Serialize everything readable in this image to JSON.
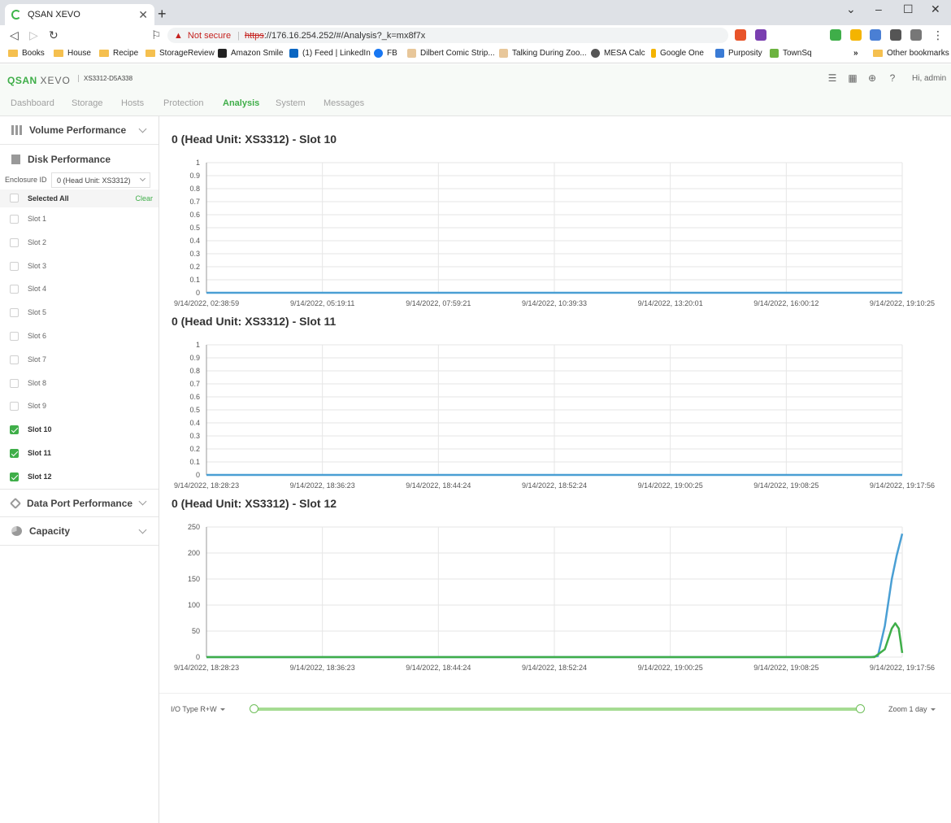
{
  "browser": {
    "tab_title": "QSAN XEVO",
    "tab_close": "✕",
    "new_tab": "+",
    "not_secure": "Not secure",
    "url_scheme": "https",
    "url_rest": "://176.16.254.252/#/Analysis?_k=mx8f7x",
    "bookmarks": [
      "Books",
      "House",
      "Recipe",
      "StorageReview",
      "Amazon Smile",
      "(1) Feed | LinkedIn",
      "FB",
      "Dilbert Comic Strip...",
      "Talking During Zoo...",
      "MESA Calc",
      "Google One",
      "Purposity",
      "TownSq"
    ],
    "bookmarks_more": "»",
    "other_bookmarks": "Other bookmarks"
  },
  "app": {
    "logo_brand": "QSAN",
    "logo_product": "XEVO",
    "model": "XS3312-D5A338",
    "greeting": "Hi, admin",
    "nav_tabs": [
      "Dashboard",
      "Storage",
      "Hosts",
      "Protection",
      "Analysis",
      "System",
      "Messages"
    ],
    "active_tab": "Analysis"
  },
  "sidebar": {
    "sections": {
      "volume": "Volume Performance",
      "disk": "Disk Performance",
      "dataport": "Data Port Performance",
      "capacity": "Capacity"
    },
    "enclosure_label": "Enclosure ID",
    "enclosure_value": "0 (Head Unit: XS3312)",
    "selected_all": "Selected All",
    "clear": "Clear",
    "slots": [
      {
        "label": "Slot 1",
        "checked": false
      },
      {
        "label": "Slot 2",
        "checked": false
      },
      {
        "label": "Slot 3",
        "checked": false
      },
      {
        "label": "Slot 4",
        "checked": false
      },
      {
        "label": "Slot 5",
        "checked": false
      },
      {
        "label": "Slot 6",
        "checked": false
      },
      {
        "label": "Slot 7",
        "checked": false
      },
      {
        "label": "Slot 8",
        "checked": false
      },
      {
        "label": "Slot 9",
        "checked": false
      },
      {
        "label": "Slot 10",
        "checked": true
      },
      {
        "label": "Slot 11",
        "checked": true
      },
      {
        "label": "Slot 12",
        "checked": true
      }
    ]
  },
  "footer": {
    "io_type": "I/O Type R+W",
    "zoom": "Zoom 1 day"
  },
  "colors": {
    "accent": "#3fae49",
    "series_blue": "#4a9fd4",
    "series_green": "#3fae49"
  },
  "chart_data": [
    {
      "type": "line",
      "title": "0 (Head Unit: XS3312) - Slot 10",
      "x_labels": [
        "9/14/2022, 02:38:59",
        "9/14/2022, 05:19:11",
        "9/14/2022, 07:59:21",
        "9/14/2022, 10:39:33",
        "9/14/2022, 13:20:01",
        "9/14/2022, 16:00:12",
        "9/14/2022, 19:10:25"
      ],
      "y_ticks": [
        "1",
        "0.9",
        "0.8",
        "0.7",
        "0.6",
        "0.5",
        "0.4",
        "0.3",
        "0.2",
        "0.1",
        "0"
      ],
      "ylim": [
        0,
        1
      ],
      "grid": true,
      "series": [
        {
          "values": [
            0,
            0,
            0,
            0,
            0,
            0,
            0,
            0,
            0,
            0,
            0,
            0,
            0,
            0,
            0,
            0,
            0,
            0,
            0,
            0,
            0,
            0,
            0,
            0,
            0
          ]
        }
      ]
    },
    {
      "type": "line",
      "title": "0 (Head Unit: XS3312) - Slot 11",
      "x_labels": [
        "9/14/2022, 18:28:23",
        "9/14/2022, 18:36:23",
        "9/14/2022, 18:44:24",
        "9/14/2022, 18:52:24",
        "9/14/2022, 19:00:25",
        "9/14/2022, 19:08:25",
        "9/14/2022, 19:17:56"
      ],
      "y_ticks": [
        "1",
        "0.9",
        "0.8",
        "0.7",
        "0.6",
        "0.5",
        "0.4",
        "0.3",
        "0.2",
        "0.1",
        "0"
      ],
      "ylim": [
        0,
        1
      ],
      "grid": true,
      "series": [
        {
          "values": [
            0,
            0,
            0,
            0,
            0,
            0,
            0,
            0,
            0,
            0,
            0,
            0,
            0,
            0,
            0,
            0,
            0,
            0,
            0,
            0,
            0,
            0,
            0,
            0,
            0
          ]
        }
      ]
    },
    {
      "type": "line",
      "title": "0 (Head Unit: XS3312) - Slot 12",
      "x_labels": [
        "9/14/2022, 18:28:23",
        "9/14/2022, 18:36:23",
        "9/14/2022, 18:44:24",
        "9/14/2022, 18:52:24",
        "9/14/2022, 19:00:25",
        "9/14/2022, 19:08:25",
        "9/14/2022, 19:17:56"
      ],
      "y_ticks": [
        "250",
        "200",
        "150",
        "100",
        "50",
        "0"
      ],
      "ylim": [
        0,
        250
      ],
      "grid": true,
      "series": [
        {
          "color": "#4a9fd4",
          "points": [
            [
              0,
              0
            ],
            [
              0.955,
              0
            ],
            [
              0.965,
              2
            ],
            [
              0.975,
              60
            ],
            [
              0.985,
              150
            ],
            [
              0.992,
              195
            ],
            [
              1.0,
              237
            ]
          ]
        },
        {
          "color": "#3fae49",
          "points": [
            [
              0,
              0
            ],
            [
              0.96,
              0
            ],
            [
              0.975,
              15
            ],
            [
              0.985,
              55
            ],
            [
              0.99,
              65
            ],
            [
              0.995,
              55
            ],
            [
              1.0,
              8
            ]
          ]
        }
      ]
    }
  ]
}
